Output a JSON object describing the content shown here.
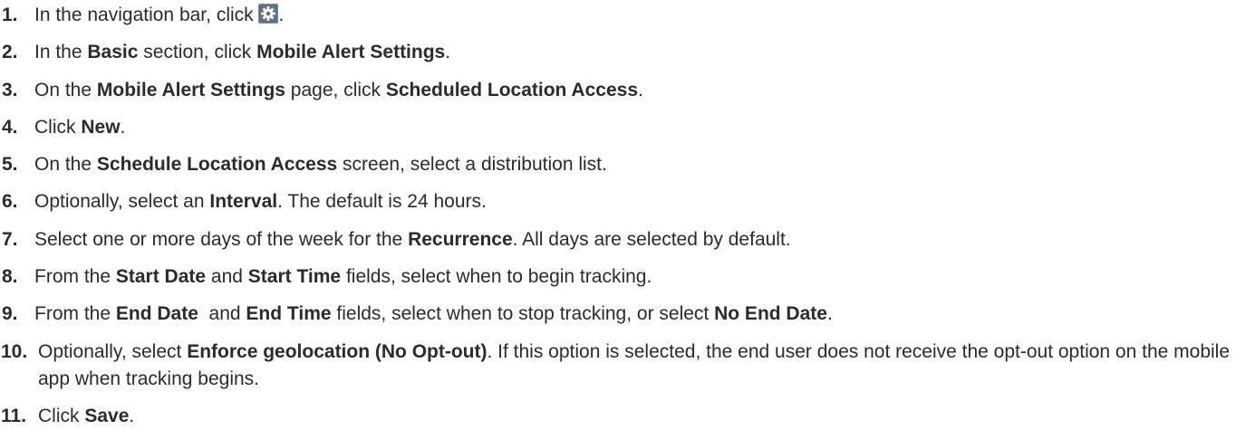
{
  "steps": [
    {
      "num": "1.",
      "parts": [
        "In the navigation bar, click ",
        "."
      ],
      "icon": "gear-icon"
    },
    {
      "num": "2.",
      "parts": [
        "In the ",
        "Basic",
        " section, click ",
        "Mobile Alert Settings",
        "."
      ]
    },
    {
      "num": "3.",
      "parts": [
        "On the ",
        "Mobile Alert Settings",
        " page, click ",
        "Scheduled Location Access",
        "."
      ]
    },
    {
      "num": "4.",
      "parts": [
        "Click ",
        "New",
        "."
      ]
    },
    {
      "num": "5.",
      "parts": [
        "On the ",
        "Schedule Location Access",
        " screen, select a distribution list."
      ]
    },
    {
      "num": "6.",
      "parts": [
        "Optionally, select an ",
        "Interval",
        ". The default is 24 hours."
      ]
    },
    {
      "num": "7.",
      "parts": [
        "Select one or more days of the week for the ",
        "Recurrence",
        ". All days are selected by default."
      ]
    },
    {
      "num": "8.",
      "parts": [
        "From the ",
        "Start Date",
        " and ",
        "Start Time",
        " fields, select when to begin tracking."
      ]
    },
    {
      "num": "9.",
      "parts": [
        "From the ",
        "End Date",
        "  and ",
        "End Time",
        " fields, select when to stop tracking, or select ",
        "No End Date",
        "."
      ]
    },
    {
      "num": "10.",
      "parts": [
        "Optionally, select ",
        "Enforce geolocation (No Opt-out)",
        ". If this option is selected, the end user does not receive the opt-out option on the mobile app when tracking begins."
      ]
    },
    {
      "num": "11.",
      "parts": [
        "Click ",
        "Save",
        "."
      ]
    }
  ]
}
